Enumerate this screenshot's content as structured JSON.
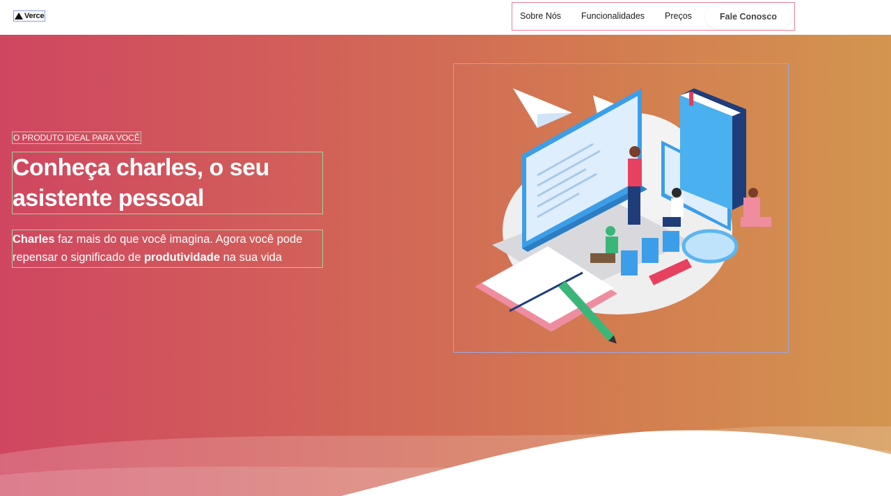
{
  "brand": {
    "logo_text": "Verce"
  },
  "nav": {
    "links": [
      "Sobre Nós",
      "Funcionalidades",
      "Preços"
    ],
    "cta": "Fale Conosco"
  },
  "hero": {
    "eyebrow": "O PRODUTO IDEAL PARA VOCÊ",
    "headline": "Conheça charles, o seu asistente pessoal",
    "subtitle": {
      "part1": "Charles",
      "part2": " faz mais do que você imagina. Agora você pode repensar o significado de ",
      "part3": "produtividade",
      "part4": " na sua vida"
    }
  },
  "colors": {
    "gradient_start": "#d04660",
    "gradient_end": "#d39550",
    "nav_outline": "#ef7d99",
    "text_outline": "#a6d3a0",
    "image_outline": "#9aa7e8"
  },
  "icons": {
    "logo": "triangle-logo-icon",
    "hero_image": "productivity-isometric-illustration"
  }
}
